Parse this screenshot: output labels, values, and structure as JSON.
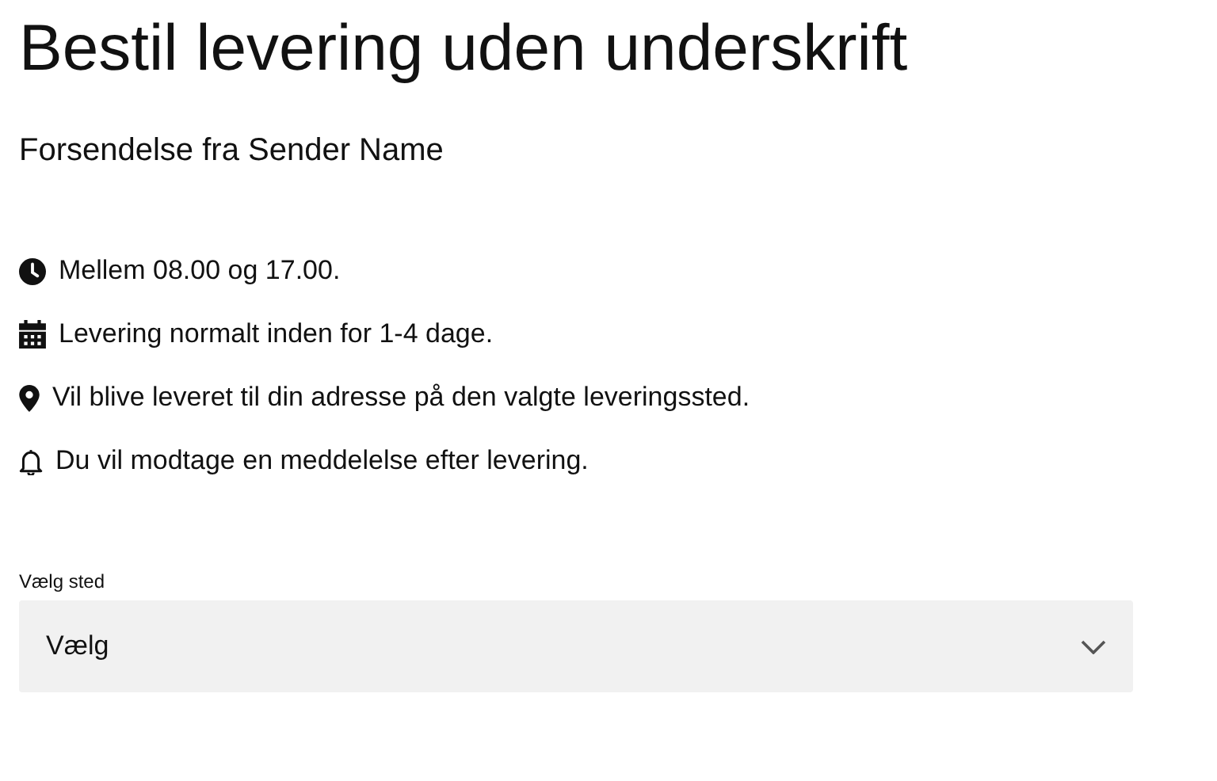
{
  "title": "Bestil levering uden underskrift",
  "subtitle": "Forsendelse fra Sender Name",
  "info": [
    {
      "kind": "clock",
      "text": "Mellem 08.00 og 17.00."
    },
    {
      "kind": "calendar",
      "text": "Levering normalt inden for 1-4 dage."
    },
    {
      "kind": "pin",
      "text": "Vil blive leveret til din adresse på den valgte leveringssted."
    },
    {
      "kind": "bell",
      "text": "Du vil modtage en meddelelse efter levering."
    }
  ],
  "select": {
    "label": "Vælg sted",
    "value": "Vælg"
  }
}
